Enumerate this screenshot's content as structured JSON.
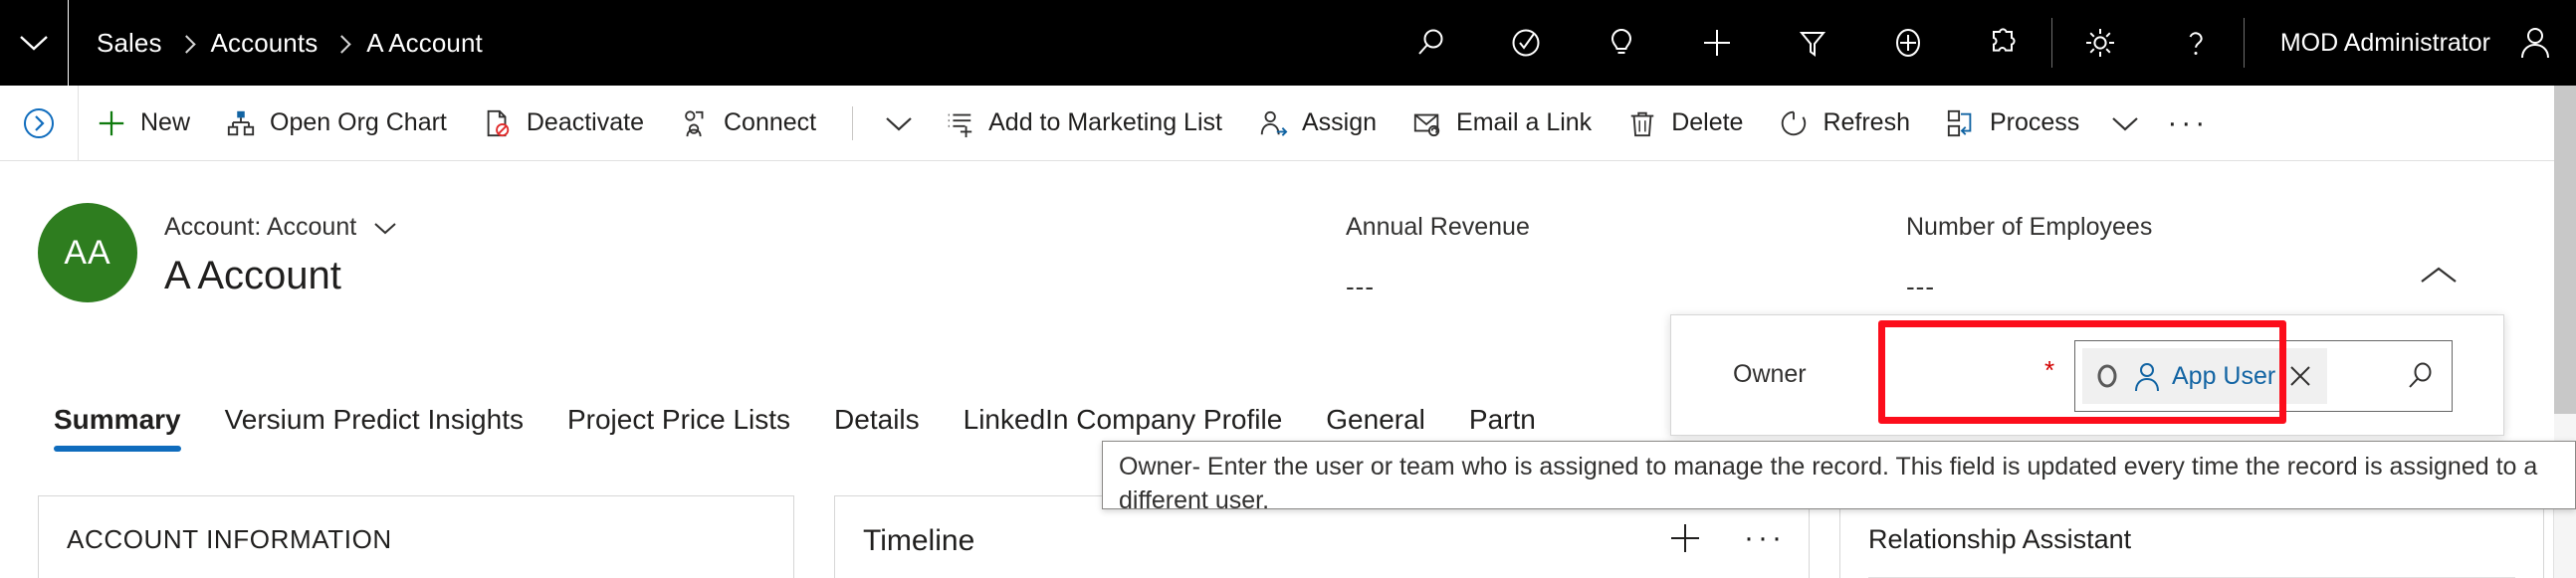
{
  "topbar": {
    "app_menu_icon": "chevron-down-icon",
    "breadcrumb": {
      "items": [
        {
          "label": "Sales"
        },
        {
          "label": "Accounts"
        },
        {
          "label": "A Account"
        }
      ]
    },
    "icons": [
      {
        "name": "search-icon",
        "title": "Search"
      },
      {
        "name": "assistant-check-icon",
        "title": "Assistant"
      },
      {
        "name": "lightbulb-icon",
        "title": "Insights"
      },
      {
        "name": "plus-icon",
        "title": "Quick create"
      },
      {
        "name": "filter-icon",
        "title": "Filter"
      },
      {
        "name": "plus-circle-icon",
        "title": "Add"
      },
      {
        "name": "puzzle-icon",
        "title": "Extensions"
      },
      {
        "name": "gear-icon",
        "title": "Settings"
      },
      {
        "name": "question-icon",
        "title": "Help"
      }
    ],
    "user": {
      "name": "MOD Administrator",
      "avatar_icon": "person-icon"
    }
  },
  "commandbar": {
    "expand_icon": "chevron-right-circle-icon",
    "buttons": [
      {
        "label": "New",
        "icon": "plus-icon"
      },
      {
        "label": "Open Org Chart",
        "icon": "org-chart-icon"
      },
      {
        "label": "Deactivate",
        "icon": "deactivate-document-icon"
      },
      {
        "label": "Connect",
        "icon": "connect-people-icon"
      },
      {
        "label": "Add to Marketing List",
        "icon": "add-to-list-icon"
      },
      {
        "label": "Assign",
        "icon": "assign-person-icon"
      },
      {
        "label": "Email a Link",
        "icon": "email-link-icon"
      },
      {
        "label": "Delete",
        "icon": "trash-icon"
      },
      {
        "label": "Refresh",
        "icon": "refresh-icon"
      },
      {
        "label": "Process",
        "icon": "process-flow-icon"
      }
    ],
    "connect_chevron_icon": "chevron-down-icon",
    "process_chevron_icon": "chevron-down-icon",
    "overflow_label": "···"
  },
  "record_header": {
    "avatar_initials": "AA",
    "entity_label": "Account: Account",
    "entity_chevron_icon": "chevron-down-icon",
    "title": "A Account",
    "collapse_icon": "chevron-up-icon",
    "fields": [
      {
        "label": "Annual Revenue",
        "value": "---"
      },
      {
        "label": "Number of Employees",
        "value": "---"
      }
    ]
  },
  "owner_field": {
    "label": "Owner",
    "required_marker": "*",
    "avatar_icon": "ring-avatar-icon",
    "person_icon": "person-icon",
    "value": "App User",
    "remove_icon": "close-icon",
    "search_icon": "search-icon"
  },
  "tabs": [
    {
      "label": "Summary",
      "active": true
    },
    {
      "label": "Versium Predict Insights",
      "active": false
    },
    {
      "label": "Project Price Lists",
      "active": false
    },
    {
      "label": "Details",
      "active": false
    },
    {
      "label": "LinkedIn Company Profile",
      "active": false
    },
    {
      "label": "General",
      "active": false
    },
    {
      "label": "Partn",
      "active": false
    }
  ],
  "tooltip": {
    "text": "Owner- Enter the user or team who is assigned to manage the record. This field is updated every time the record is assigned to a different user."
  },
  "cards": {
    "account_information": {
      "title": "ACCOUNT INFORMATION"
    },
    "timeline": {
      "title": "Timeline",
      "add_icon": "plus-icon",
      "more_label": "···"
    },
    "relationship_assistant": {
      "title": "Relationship Assistant"
    }
  },
  "colors": {
    "topbar_bg": "#000000",
    "accent_blue": "#0f6cbd",
    "link_blue": "#1264a3",
    "avatar_green": "#2E7D1F",
    "annotation_red": "#fc0d1b",
    "required_red": "#d20000"
  }
}
